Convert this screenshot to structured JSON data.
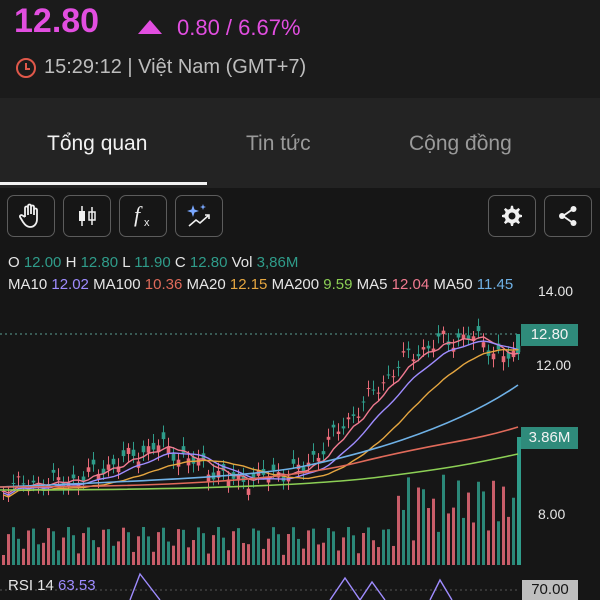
{
  "quote": {
    "price": "12.80",
    "change": "0.80 / 6.67%",
    "time": "15:29:12 | Việt Nam (GMT+7)",
    "up_color": "#e24ee0"
  },
  "tabs": [
    {
      "label": "Tổng quan",
      "active": true
    },
    {
      "label": "Tin tức",
      "active": false
    },
    {
      "label": "Cộng đồng",
      "active": false
    }
  ],
  "toolbar": {
    "icons": [
      "hand-icon",
      "candlestick-icon",
      "function-icon",
      "sparkle-trend-icon",
      "settings-icon",
      "share-icon"
    ]
  },
  "ohlc": {
    "o_label": "O",
    "o": "12.00",
    "h_label": "H",
    "h": "12.80",
    "l_label": "L",
    "l": "11.90",
    "c_label": "C",
    "c": "12.80",
    "vol_label": "Vol",
    "vol": "3,86M"
  },
  "ma": {
    "ma10_label": "MA10",
    "ma10": "12.02",
    "ma100_label": "MA100",
    "ma100": "10.36",
    "ma20_label": "MA20",
    "ma20": "12.15",
    "ma200_label": "MA200",
    "ma200": "9.59",
    "ma5_label": "MA5",
    "ma5": "12.04",
    "ma50_label": "MA50",
    "ma50": "11.45"
  },
  "axis": {
    "p14": "14.00",
    "p12": "12.00",
    "p8": "8.00",
    "last_price": "12.80",
    "volume": "3.86M",
    "rsi_level": "70.00"
  },
  "rsi": {
    "label": "RSI 14",
    "value": "63.53"
  },
  "colors": {
    "up": "#e86a78",
    "down": "#2f9c8a",
    "ma10": "#9f8cff",
    "ma100": "#e06a5a",
    "ma20": "#e5a640",
    "ma200": "#8ccf55",
    "ma5": "#f07a90",
    "ma50": "#6fb1e6"
  }
}
